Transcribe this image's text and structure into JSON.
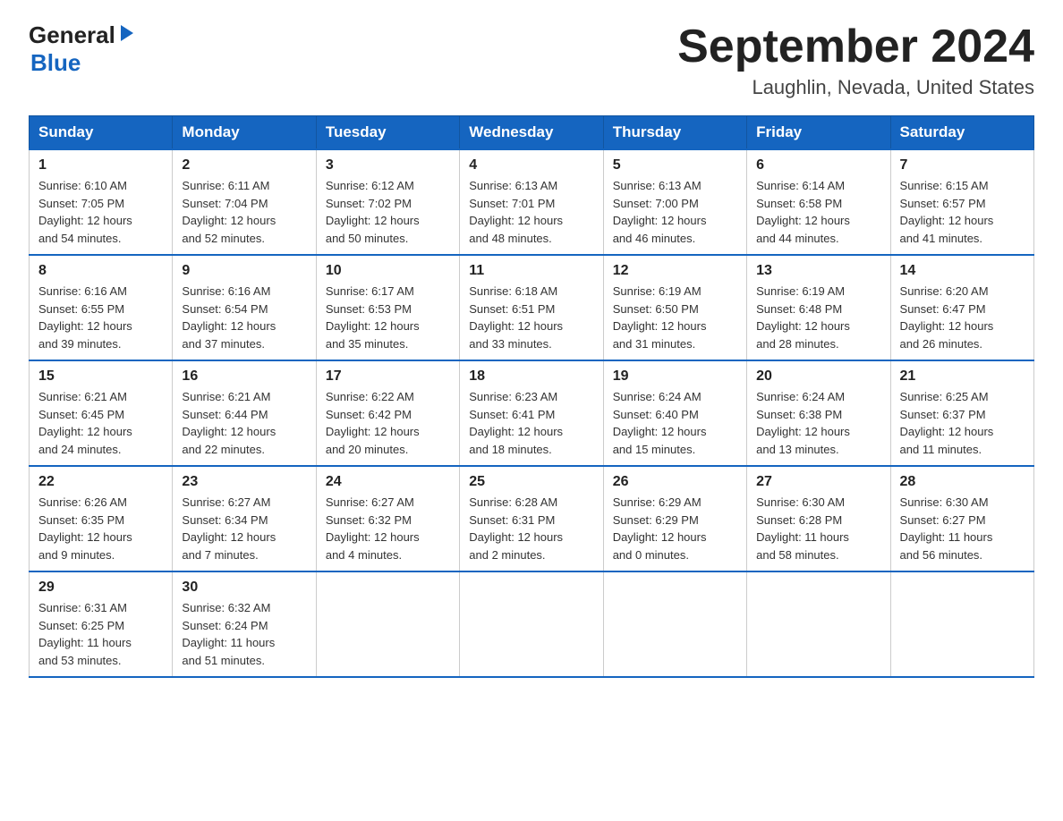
{
  "logo": {
    "text_general": "General",
    "text_blue": "Blue",
    "arrow_symbol": "▶"
  },
  "title": "September 2024",
  "subtitle": "Laughlin, Nevada, United States",
  "weekdays": [
    "Sunday",
    "Monday",
    "Tuesday",
    "Wednesday",
    "Thursday",
    "Friday",
    "Saturday"
  ],
  "weeks": [
    [
      {
        "day": "1",
        "sunrise": "6:10 AM",
        "sunset": "7:05 PM",
        "daylight": "12 hours and 54 minutes."
      },
      {
        "day": "2",
        "sunrise": "6:11 AM",
        "sunset": "7:04 PM",
        "daylight": "12 hours and 52 minutes."
      },
      {
        "day": "3",
        "sunrise": "6:12 AM",
        "sunset": "7:02 PM",
        "daylight": "12 hours and 50 minutes."
      },
      {
        "day": "4",
        "sunrise": "6:13 AM",
        "sunset": "7:01 PM",
        "daylight": "12 hours and 48 minutes."
      },
      {
        "day": "5",
        "sunrise": "6:13 AM",
        "sunset": "7:00 PM",
        "daylight": "12 hours and 46 minutes."
      },
      {
        "day": "6",
        "sunrise": "6:14 AM",
        "sunset": "6:58 PM",
        "daylight": "12 hours and 44 minutes."
      },
      {
        "day": "7",
        "sunrise": "6:15 AM",
        "sunset": "6:57 PM",
        "daylight": "12 hours and 41 minutes."
      }
    ],
    [
      {
        "day": "8",
        "sunrise": "6:16 AM",
        "sunset": "6:55 PM",
        "daylight": "12 hours and 39 minutes."
      },
      {
        "day": "9",
        "sunrise": "6:16 AM",
        "sunset": "6:54 PM",
        "daylight": "12 hours and 37 minutes."
      },
      {
        "day": "10",
        "sunrise": "6:17 AM",
        "sunset": "6:53 PM",
        "daylight": "12 hours and 35 minutes."
      },
      {
        "day": "11",
        "sunrise": "6:18 AM",
        "sunset": "6:51 PM",
        "daylight": "12 hours and 33 minutes."
      },
      {
        "day": "12",
        "sunrise": "6:19 AM",
        "sunset": "6:50 PM",
        "daylight": "12 hours and 31 minutes."
      },
      {
        "day": "13",
        "sunrise": "6:19 AM",
        "sunset": "6:48 PM",
        "daylight": "12 hours and 28 minutes."
      },
      {
        "day": "14",
        "sunrise": "6:20 AM",
        "sunset": "6:47 PM",
        "daylight": "12 hours and 26 minutes."
      }
    ],
    [
      {
        "day": "15",
        "sunrise": "6:21 AM",
        "sunset": "6:45 PM",
        "daylight": "12 hours and 24 minutes."
      },
      {
        "day": "16",
        "sunrise": "6:21 AM",
        "sunset": "6:44 PM",
        "daylight": "12 hours and 22 minutes."
      },
      {
        "day": "17",
        "sunrise": "6:22 AM",
        "sunset": "6:42 PM",
        "daylight": "12 hours and 20 minutes."
      },
      {
        "day": "18",
        "sunrise": "6:23 AM",
        "sunset": "6:41 PM",
        "daylight": "12 hours and 18 minutes."
      },
      {
        "day": "19",
        "sunrise": "6:24 AM",
        "sunset": "6:40 PM",
        "daylight": "12 hours and 15 minutes."
      },
      {
        "day": "20",
        "sunrise": "6:24 AM",
        "sunset": "6:38 PM",
        "daylight": "12 hours and 13 minutes."
      },
      {
        "day": "21",
        "sunrise": "6:25 AM",
        "sunset": "6:37 PM",
        "daylight": "12 hours and 11 minutes."
      }
    ],
    [
      {
        "day": "22",
        "sunrise": "6:26 AM",
        "sunset": "6:35 PM",
        "daylight": "12 hours and 9 minutes."
      },
      {
        "day": "23",
        "sunrise": "6:27 AM",
        "sunset": "6:34 PM",
        "daylight": "12 hours and 7 minutes."
      },
      {
        "day": "24",
        "sunrise": "6:27 AM",
        "sunset": "6:32 PM",
        "daylight": "12 hours and 4 minutes."
      },
      {
        "day": "25",
        "sunrise": "6:28 AM",
        "sunset": "6:31 PM",
        "daylight": "12 hours and 2 minutes."
      },
      {
        "day": "26",
        "sunrise": "6:29 AM",
        "sunset": "6:29 PM",
        "daylight": "12 hours and 0 minutes."
      },
      {
        "day": "27",
        "sunrise": "6:30 AM",
        "sunset": "6:28 PM",
        "daylight": "11 hours and 58 minutes."
      },
      {
        "day": "28",
        "sunrise": "6:30 AM",
        "sunset": "6:27 PM",
        "daylight": "11 hours and 56 minutes."
      }
    ],
    [
      {
        "day": "29",
        "sunrise": "6:31 AM",
        "sunset": "6:25 PM",
        "daylight": "11 hours and 53 minutes."
      },
      {
        "day": "30",
        "sunrise": "6:32 AM",
        "sunset": "6:24 PM",
        "daylight": "11 hours and 51 minutes."
      },
      null,
      null,
      null,
      null,
      null
    ]
  ],
  "labels": {
    "sunrise": "Sunrise:",
    "sunset": "Sunset:",
    "daylight": "Daylight:"
  }
}
